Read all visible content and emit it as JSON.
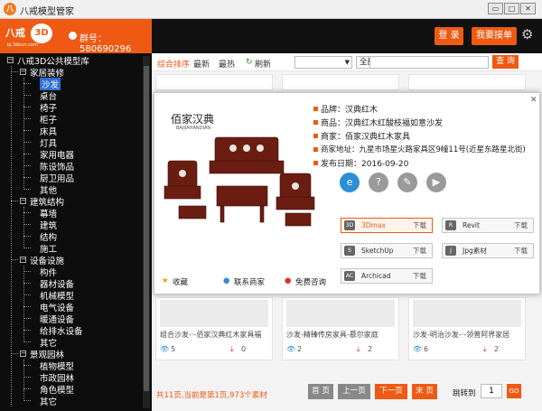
{
  "window": {
    "title": "八戒模型管家",
    "app_icon": "八",
    "controls": [
      "▭",
      "□",
      "✕"
    ]
  },
  "header": {
    "logo_text": "八戒",
    "logo_3d": "3D",
    "logo_url": "bj.3dcun.com",
    "group_label": "群号：580690296",
    "login_label": "登 录",
    "takeorder_label": "我要接单",
    "gear_icon": "⚙"
  },
  "sidebar": {
    "root": "八戒3D公共模型库",
    "groups": [
      {
        "label": "家居装修",
        "items": [
          "沙发",
          "桌台",
          "椅子",
          "柜子",
          "床具",
          "灯具",
          "家用电器",
          "陈设饰品",
          "厨卫用品",
          "其他"
        ]
      },
      {
        "label": "建筑结构",
        "items": [
          "幕墙",
          "建筑",
          "结构",
          "施工"
        ]
      },
      {
        "label": "设备设施",
        "items": [
          "构件",
          "器材设备",
          "机械模型",
          "电气设备",
          "暖通设备",
          "给排水设备",
          "其它"
        ]
      },
      {
        "label": "景观园林",
        "items": [
          "植物模型",
          "市政园林",
          "角色模型",
          "其它"
        ]
      }
    ],
    "selected": "沙发"
  },
  "toolbar": {
    "sort_tabs": [
      "综合排序",
      "最新",
      "最热"
    ],
    "refresh_label": "刷新",
    "select1": "",
    "select2": "全部模型",
    "search_placeholder": "",
    "search_button": "查 询"
  },
  "popup": {
    "brand_logo": "佰家汉典",
    "brand_sub": "BAIJIAHANDIAN",
    "rows": [
      {
        "k": "品牌：",
        "v": "汉典红木"
      },
      {
        "k": "商品：",
        "v": "汉典红木红酸枝福如意沙发"
      },
      {
        "k": "商家：",
        "v": "佰家汉典红木家具"
      },
      {
        "k": "商家地址：",
        "v": "九星市场星火路家具区9幢11号(近星东路星北街)"
      },
      {
        "k": "发布日期：",
        "v": "2016-09-20"
      }
    ],
    "software": [
      {
        "name": "3Dmax",
        "dl": "下载",
        "icon": "3D"
      },
      {
        "name": "Revit",
        "dl": "下载",
        "icon": "R"
      },
      {
        "name": "SketchUp",
        "dl": "下载",
        "icon": "S"
      },
      {
        "name": "Jpg素材",
        "dl": "下载",
        "icon": "J"
      },
      {
        "name": "Archicad",
        "dl": "下载",
        "icon": "AC"
      }
    ],
    "footer": {
      "fav": "收藏",
      "contact": "联系商家",
      "consult": "免费咨询"
    },
    "close_icon": "✕"
  },
  "cards": [
    {
      "title": "组合沙发-·-佰家汉典红木家具福",
      "views": "5",
      "downloads": "0"
    },
    {
      "title": "沙发-精臻传房家具-慕尔家庭",
      "views": "2",
      "downloads": "2"
    },
    {
      "title": "沙发-明治沙发-·-领普阿界家居",
      "views": "6",
      "downloads": "2"
    }
  ],
  "pager": {
    "info": "共11页,当前是第1页,973个素材",
    "first": "首 页",
    "prev": "上一页",
    "next": "下一页",
    "last": "末 页",
    "jump_label": "跳转到",
    "page_value": "1",
    "go": "GO"
  },
  "colors": {
    "accent": "#ee5a13",
    "sidebar_bg": "#0d0d0d",
    "selected": "#2c6fd6"
  }
}
